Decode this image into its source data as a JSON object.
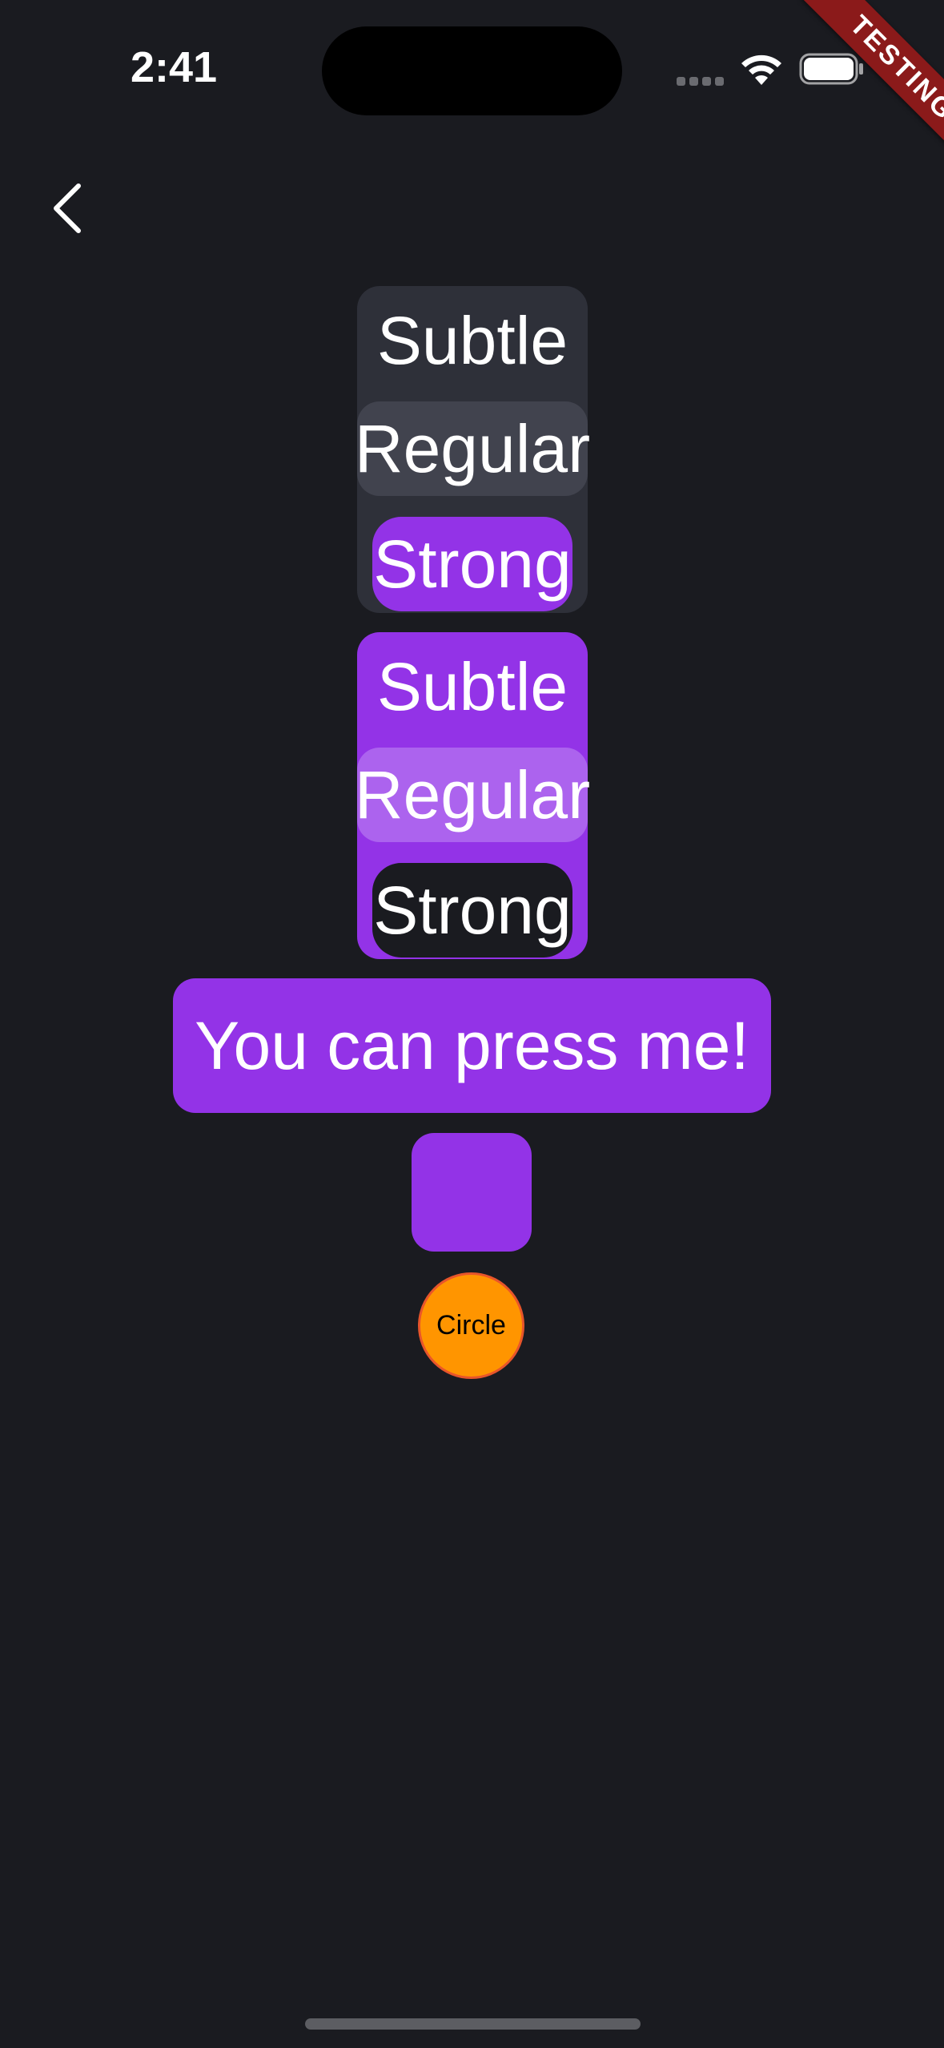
{
  "status_bar": {
    "time": "2:41"
  },
  "ribbon": {
    "label": "TESTING"
  },
  "nav": {
    "back_icon": "chevron-left-icon"
  },
  "groups": [
    {
      "subtle_label": "Subtle",
      "regular_label": "Regular",
      "strong_label": "Strong"
    },
    {
      "subtle_label": "Subtle",
      "regular_label": "Regular",
      "strong_label": "Strong"
    }
  ],
  "press_button": {
    "label": "You can press me!"
  },
  "circle_button": {
    "label": "Circle"
  },
  "colors": {
    "background": "#1a1b20",
    "accent": "#9333e7",
    "circle": "#ff9500",
    "ribbon": "#8b1a1a"
  }
}
